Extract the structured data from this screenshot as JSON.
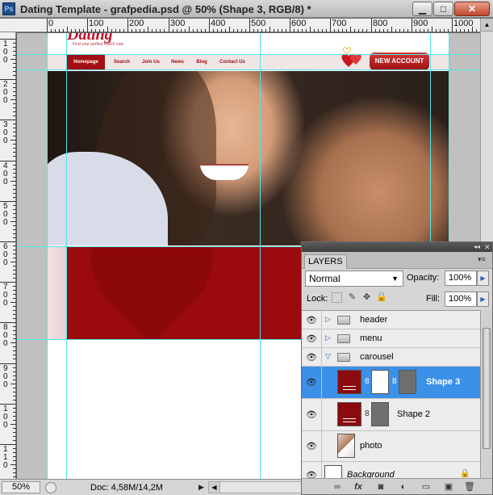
{
  "window": {
    "title": "Dating Template - grafpedia.psd @ 50% (Shape 3, RGB/8) *",
    "app_icon": "Ps",
    "minimize_glyph": "▁",
    "maximize_glyph": "□",
    "close_glyph": "✕"
  },
  "rulers": {
    "top_labels": [
      "0",
      "100",
      "200",
      "300",
      "400",
      "500",
      "600",
      "700",
      "800",
      "900",
      "1000"
    ],
    "left_labels": [
      "1\n0\n0",
      "2\n0\n0",
      "3\n0\n0",
      "4\n0\n0",
      "5\n0\n0",
      "6\n0\n0",
      "7\n0\n0",
      "8\n0\n0",
      "9\n0\n0",
      "1\n0\n0",
      "1\n1\n0"
    ]
  },
  "canvas": {
    "logo": "Dating",
    "tagline": "Find your perfect match now",
    "nav": [
      "Homepage",
      "Search",
      "Join Us",
      "News",
      "Blog",
      "Contact Us"
    ],
    "new_account": "NEW ACCOUNT"
  },
  "status": {
    "zoom": "50%",
    "doc_info": "Doc: 4,58M/14,2M",
    "arrow": "▶"
  },
  "layers_panel": {
    "tab": "LAYERS",
    "menu_glyph": "▾≡",
    "blend_mode": "Normal",
    "opacity_label": "Opacity:",
    "opacity": "100%",
    "lock_label": "Lock:",
    "fill_label": "Fill:",
    "fill": "100%",
    "layers": [
      {
        "name": "header",
        "type": "group",
        "expanded": false,
        "visible": true
      },
      {
        "name": "menu",
        "type": "group",
        "expanded": false,
        "visible": true
      },
      {
        "name": "carousel",
        "type": "group",
        "expanded": true,
        "visible": true
      },
      {
        "name": "Shape 3",
        "type": "shape",
        "selected": true,
        "visible": true
      },
      {
        "name": "Shape 2",
        "type": "shape",
        "selected": false,
        "visible": true
      },
      {
        "name": "photo",
        "type": "smart-object",
        "visible": true
      },
      {
        "name": "Background",
        "type": "background",
        "locked": true,
        "visible": true
      }
    ],
    "footer_icons": [
      "link-icon",
      "fx-icon",
      "mask-icon",
      "adjustment-icon",
      "folder-icon",
      "new-layer-icon",
      "trash-icon"
    ]
  },
  "icons": {
    "eye": "👁",
    "twisty_closed": "▷",
    "twisty_open": "▽",
    "chain": "8",
    "lock": "🔒",
    "caret_down": "▼",
    "arrow_right": "▶"
  },
  "colors": {
    "selection": "#3b90e8",
    "guides": "#4fe6e6",
    "carousel_red": "#9b0a0e"
  }
}
